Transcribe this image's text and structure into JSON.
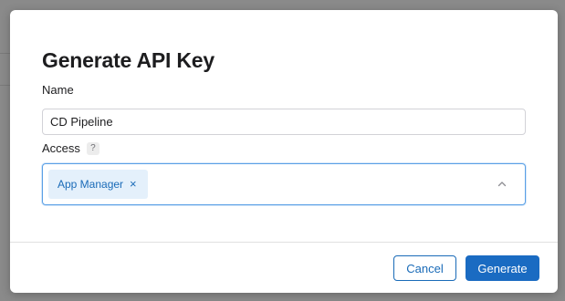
{
  "dialog": {
    "title": "Generate API Key",
    "name_label": "Name",
    "name_value": "CD Pipeline",
    "access_label": "Access",
    "access_help": "?",
    "access_selected": [
      {
        "label": "App Manager",
        "remove_glyph": "×"
      }
    ],
    "dropdown_icon": "chevron-up-icon",
    "cancel_label": "Cancel",
    "generate_label": "Generate"
  },
  "colors": {
    "primary": "#1a6bc2",
    "chip_background": "#e4f0fb",
    "chip_text": "#1a6bb8",
    "backdrop": "#8a8a8a"
  }
}
